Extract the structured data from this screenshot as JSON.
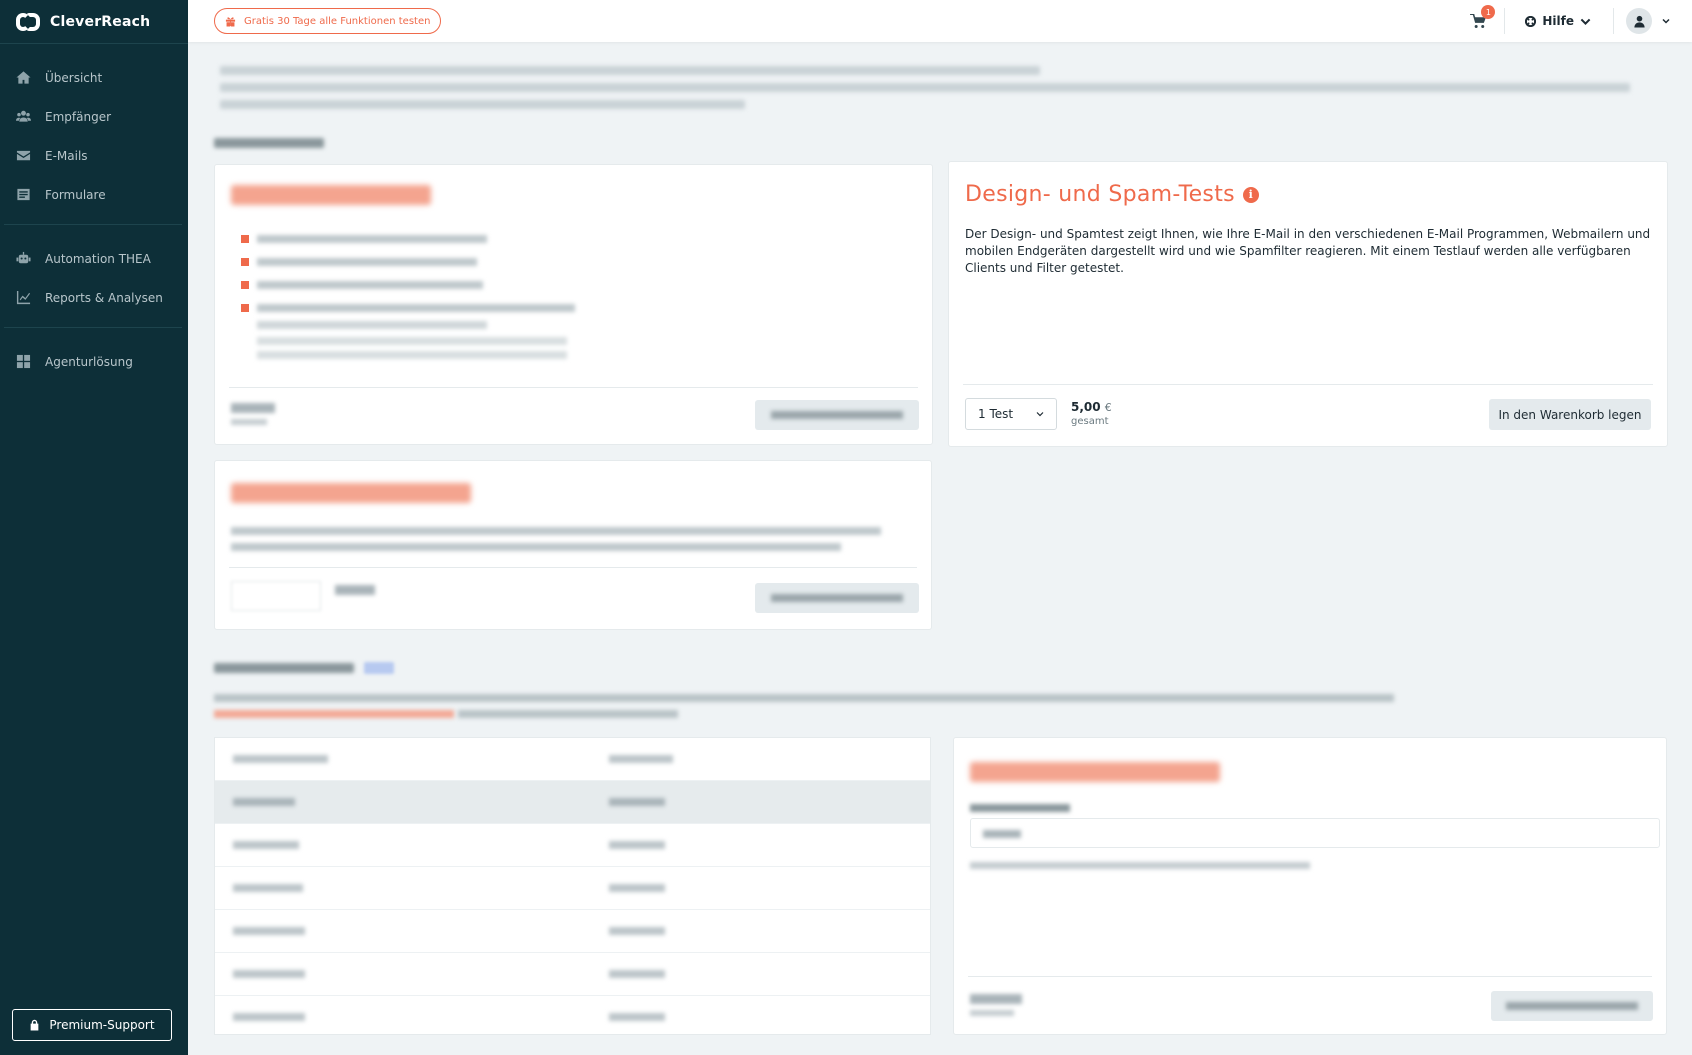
{
  "brand": {
    "name": "CleverReach"
  },
  "sidebar": {
    "groups": [
      [
        {
          "label": "Übersicht",
          "icon": "home-icon"
        },
        {
          "label": "Empfänger",
          "icon": "users-icon"
        },
        {
          "label": "E-Mails",
          "icon": "envelope-icon"
        },
        {
          "label": "Formulare",
          "icon": "form-icon"
        }
      ],
      [
        {
          "label": "Automation THEA",
          "icon": "robot-icon"
        },
        {
          "label": "Reports & Analysen",
          "icon": "chart-icon"
        }
      ],
      [
        {
          "label": "Agenturlösung",
          "icon": "grid-icon"
        }
      ]
    ],
    "premium_button": "Premium-Support"
  },
  "topbar": {
    "trial_button": "Gratis 30 Tage alle Funktionen testen",
    "cart_count": "1",
    "help_label": "Hilfe"
  },
  "design_spam": {
    "title": "Design- und Spam-Tests",
    "info": "i",
    "description": "Der Design- und Spamtest zeigt Ihnen, wie Ihre E-Mail in den verschiedenen E-Mail Programmen, Webmailern und mobilen Endgeräten dargestellt wird und wie Spamfilter reagieren. Mit einem Testlauf werden alle verfügbaren Clients und Filter getestet.",
    "select_value": "1 Test",
    "price": "5,00",
    "currency": "€",
    "price_label": "gesamt",
    "cart_button": "In den Warenkorb legen"
  },
  "colors": {
    "accent": "#ef6a4b",
    "sidebar": "#0d2f38",
    "background": "#eff3f5"
  }
}
